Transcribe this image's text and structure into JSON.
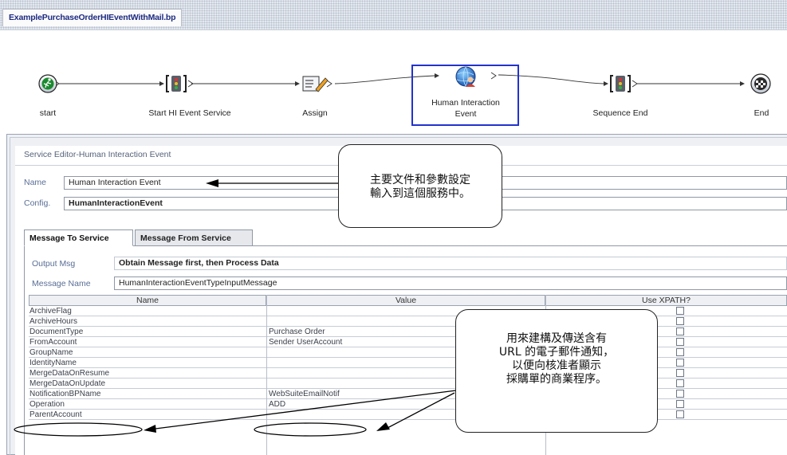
{
  "file_tab": {
    "label": "ExamplePurchaseOrderHIEventWithMail.bp"
  },
  "flow": {
    "nodes": [
      {
        "id": "start",
        "label": "start",
        "icon": "start-runner-icon"
      },
      {
        "id": "start-hi",
        "label": "Start HI Event Service",
        "icon": "service-icon"
      },
      {
        "id": "assign",
        "label": "Assign",
        "icon": "assign-icon"
      },
      {
        "id": "hie",
        "label": "Human Interaction Event",
        "icon": "globe-person-icon",
        "selected": true
      },
      {
        "id": "seq-end",
        "label": "Sequence End",
        "icon": "service-icon"
      },
      {
        "id": "end",
        "label": "End",
        "icon": "end-icon"
      }
    ]
  },
  "editor": {
    "title": "Service Editor-Human Interaction Event",
    "name_label": "Name",
    "name_value": "Human Interaction Event",
    "config_label": "Config.",
    "config_value": "HumanInteractionEvent",
    "tabs": [
      {
        "label": "Message To Service",
        "active": true
      },
      {
        "label": "Message From Service",
        "active": false
      }
    ],
    "output_msg_label": "Output Msg",
    "output_msg_value": "Obtain Message first, then Process Data",
    "message_name_label": "Message Name",
    "message_name_value": "HumanInteractionEventTypeInputMessage"
  },
  "table": {
    "columns": [
      "Name",
      "Value",
      "Use XPATH?"
    ],
    "rows": [
      {
        "name": "ArchiveFlag",
        "value": "",
        "xpath": false
      },
      {
        "name": "ArchiveHours",
        "value": "",
        "xpath": false
      },
      {
        "name": "DocumentType",
        "value": "Purchase Order",
        "xpath": false
      },
      {
        "name": "FromAccount",
        "value": "Sender UserAccount",
        "xpath": false
      },
      {
        "name": "GroupName",
        "value": "",
        "xpath": false
      },
      {
        "name": "IdentityName",
        "value": "",
        "xpath": false
      },
      {
        "name": "MergeDataOnResume",
        "value": "",
        "xpath": false
      },
      {
        "name": "MergeDataOnUpdate",
        "value": "",
        "xpath": false
      },
      {
        "name": "NotificationBPName",
        "value": "WebSuiteEmailNotif",
        "xpath": false
      },
      {
        "name": "Operation",
        "value": "ADD",
        "xpath": false
      },
      {
        "name": "ParentAccount",
        "value": "",
        "xpath": false
      }
    ]
  },
  "callouts": {
    "top": [
      "主要文件和參數設定",
      "輸入到這個服務中。"
    ],
    "right": [
      "用來建構及傳送含有",
      "URL 的電子郵件通知，",
      "以便向核准者顯示",
      "採購單的商業程序。"
    ]
  },
  "colors": {
    "selected_border": "#2233cc",
    "label_blue": "#5a6e96",
    "tab_text": "#1c2a80"
  }
}
